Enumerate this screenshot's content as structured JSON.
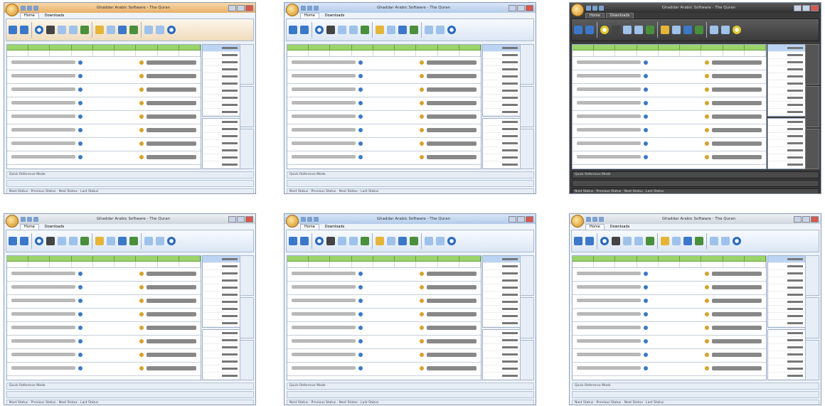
{
  "thumbnails": [
    {
      "theme": "orange",
      "title": "Ghaddar Arabic Software - The Quran"
    },
    {
      "theme": "blue",
      "title": "Ghaddar Arabic Software - The Quran"
    },
    {
      "theme": "dark",
      "title": "Ghaddar Arabic Software - The Quran"
    },
    {
      "theme": "silver",
      "title": "Ghaddar Arabic Software - The Quran"
    },
    {
      "theme": "blue",
      "title": "Ghaddar Arabic Software - The Quran"
    },
    {
      "theme": "silver",
      "title": "Ghaddar Arabic Software - The Quran"
    }
  ],
  "tabs": [
    "Home",
    "Downloads"
  ],
  "status": "Quick Reference Mode",
  "statusbar": "Next Status · Previous Status · Next Status · Last Status"
}
